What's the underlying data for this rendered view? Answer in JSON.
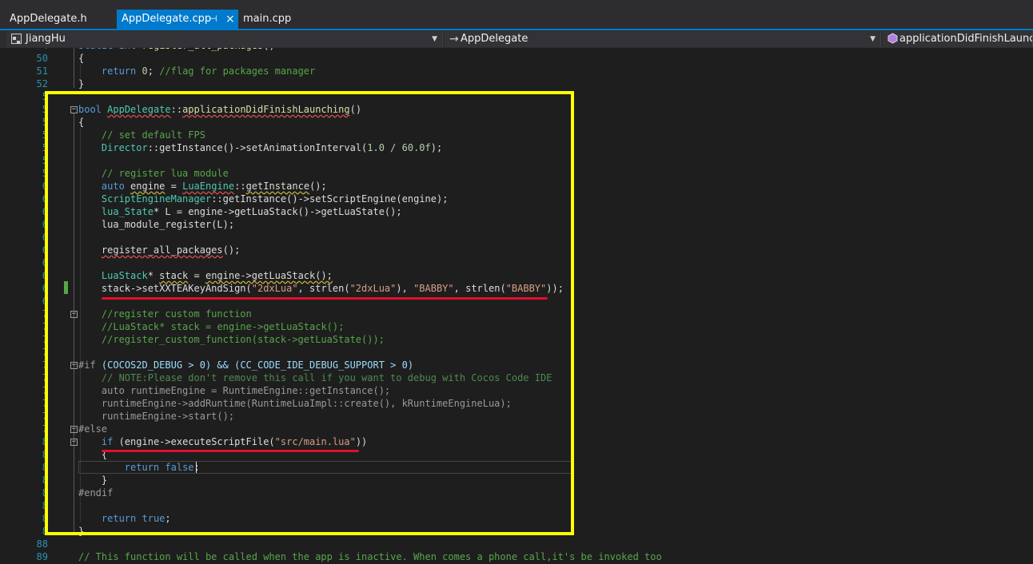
{
  "tabs": [
    {
      "label": "AppDelegate.h"
    },
    {
      "label": "AppDelegate.cpp",
      "pin": "⊣",
      "close": "×"
    },
    {
      "label": "main.cpp"
    }
  ],
  "nav": {
    "project": "JiangHu",
    "class": "AppDelegate",
    "member": "applicationDidFinishLaunching"
  },
  "line_numbers": {
    "l50": "50",
    "l51": "51",
    "l52": "52",
    "l53": "5",
    "l54": "5",
    "l55": "5",
    "l56": "5",
    "l57": "5",
    "l58": "5",
    "l59": "5",
    "l60": "6",
    "l61": "6",
    "l62": "6",
    "l63": "6",
    "l64": "6",
    "l65": "6",
    "l66": "6",
    "l67": "6",
    "l68": "6",
    "l69": "6",
    "l70": "7",
    "l71": "7",
    "l72": "7",
    "l73": "7",
    "l74": "7",
    "l75": "7",
    "l76": "7",
    "l77": "7",
    "l78": "7",
    "l79": "7",
    "l80": "8",
    "l81": "8",
    "l82": "8",
    "l83": "8",
    "l84": "8",
    "l85": "8",
    "l86": "8",
    "l87": "8",
    "l88": "88",
    "l89": "89"
  },
  "code": {
    "c50": "{",
    "c51_kw": "return",
    "c51_num": "0",
    "c51_cm": "//flag for packages manager",
    "c52": "}",
    "c54_kw": "bool",
    "c54_cls": "AppDelegate",
    "c54_fn": "applicationDidFinishLaunching",
    "c55": "{",
    "c56": "// set default FPS",
    "c57_cls": "Director",
    "c57_a": "getInstance",
    "c57_b": "setAnimationInterval",
    "c57_num": "1.0 / 60.0f",
    "c59": "// register lua module",
    "c60_kw": "auto",
    "c60_var": "engine",
    "c60_cls": "LuaEngine",
    "c60_fn": "getInstance",
    "c61_cls": "ScriptEngineManager",
    "c61_a": "getInstance",
    "c61_b": "setScriptEngine",
    "c61_arg": "engine",
    "c62_ty": "lua_State",
    "c62_rest": "* L = engine->getLuaStack()->getLuaState();",
    "c63": "lua_module_register(L);",
    "c65": "register_all_packages",
    "c67_ty": "LuaStack",
    "c67_var": "stack",
    "c67_rest": "engine->getLuaStack();",
    "c68_a": "stack->setXXTEAKeyAndSign(",
    "c68_s1": "\"2dxLua\"",
    "c68_b": ", strlen(",
    "c68_s2": "\"2dxLua\"",
    "c68_c": "), ",
    "c68_s3": "\"BABBY\"",
    "c68_d": ", strlen(",
    "c68_s4": "\"BABBY\"",
    "c68_e": "));",
    "c70": "//register custom function",
    "c71": "//LuaStack* stack = engine->getLuaStack();",
    "c72": "//register_custom_function(stack->getLuaState());",
    "c74_pp": "#if",
    "c74_rest": "(COCOS2D_DEBUG > 0) && (CC_CODE_IDE_DEBUG_SUPPORT > 0)",
    "c75": "// NOTE:Please don't remove this call if you want to debug with Cocos Code IDE",
    "c76": "auto runtimeEngine = RuntimeEngine::getInstance();",
    "c77": "runtimeEngine->addRuntime(RuntimeLuaImpl::create(), kRuntimeEngineLua);",
    "c78": "runtimeEngine->start();",
    "c79": "#else",
    "c80_kw": "if",
    "c80_a": "(engine->executeScriptFile(",
    "c80_str": "\"src/main.lua\"",
    "c80_b": "))",
    "c81": "{",
    "c82_kw": "return",
    "c82_kw2": "false",
    "c82_end": ";",
    "c83": "}",
    "c84": "#endif",
    "c86_kw": "return",
    "c86_kw2": "true",
    "c86_end": ";",
    "c87": "}",
    "c89": "// This function will be called when the app is inactive. When comes a phone call,it's be invoked too"
  },
  "colors": {
    "highlight_box": "#ffff00",
    "underline_mark": "#e0102a",
    "active_tab": "#007acc"
  }
}
